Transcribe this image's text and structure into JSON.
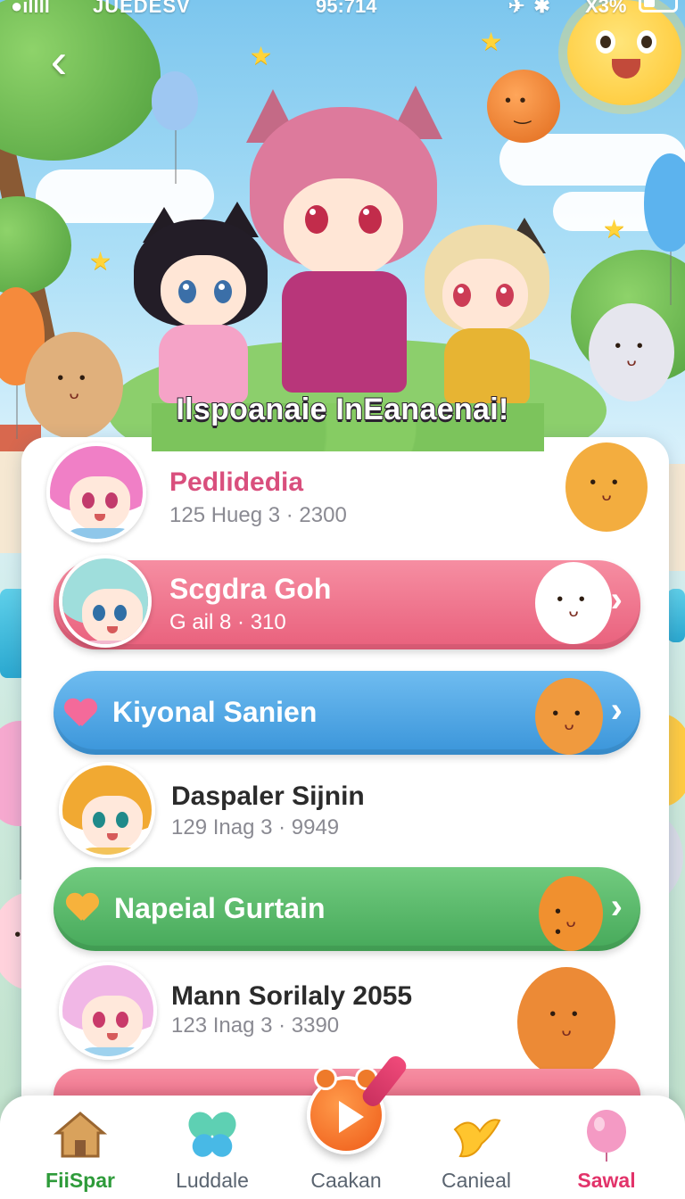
{
  "status_bar": {
    "signal": "●ıllll",
    "carrier": "JUEDESV",
    "time": "95:714",
    "battery_text": "X3%"
  },
  "back_icon": "chevron-left-icon",
  "banner": {
    "title": "Ilspoanaie InEanaenai!"
  },
  "list": {
    "items": [
      {
        "title": "Pedlidedia",
        "meta": "125 Hueg 3 · 2300"
      },
      {
        "title": "Scgdra Goh",
        "meta": "G ail 8 · 310"
      },
      {
        "title": "Kiyonal Sanien"
      },
      {
        "title": "Daspaler Sijnin",
        "meta": "129 Inag 3 · 9949"
      },
      {
        "title": "Napeial Gurtain"
      },
      {
        "title": "Mann Sorilaly 2055",
        "meta": "123 Inag 3 · 3390"
      }
    ]
  },
  "nav": {
    "items": [
      {
        "label": "FiiSpar",
        "icon": "house-icon",
        "color": "#2e9b3a"
      },
      {
        "label": "Luddale",
        "icon": "butterfly-icon",
        "color": "#5a6470"
      },
      {
        "label": "Caakan",
        "icon": "play-icon",
        "color": "#5a6470"
      },
      {
        "label": "Canieal",
        "icon": "bird-icon",
        "color": "#5a6470"
      },
      {
        "label": "Sawal",
        "icon": "balloon-icon",
        "color": "#e2336a"
      }
    ]
  },
  "colors": {
    "pink_pill": "#ef7189",
    "blue_pill": "#4aa6e6",
    "green_pill": "#55b968",
    "pink_title": "#d94f7d"
  }
}
